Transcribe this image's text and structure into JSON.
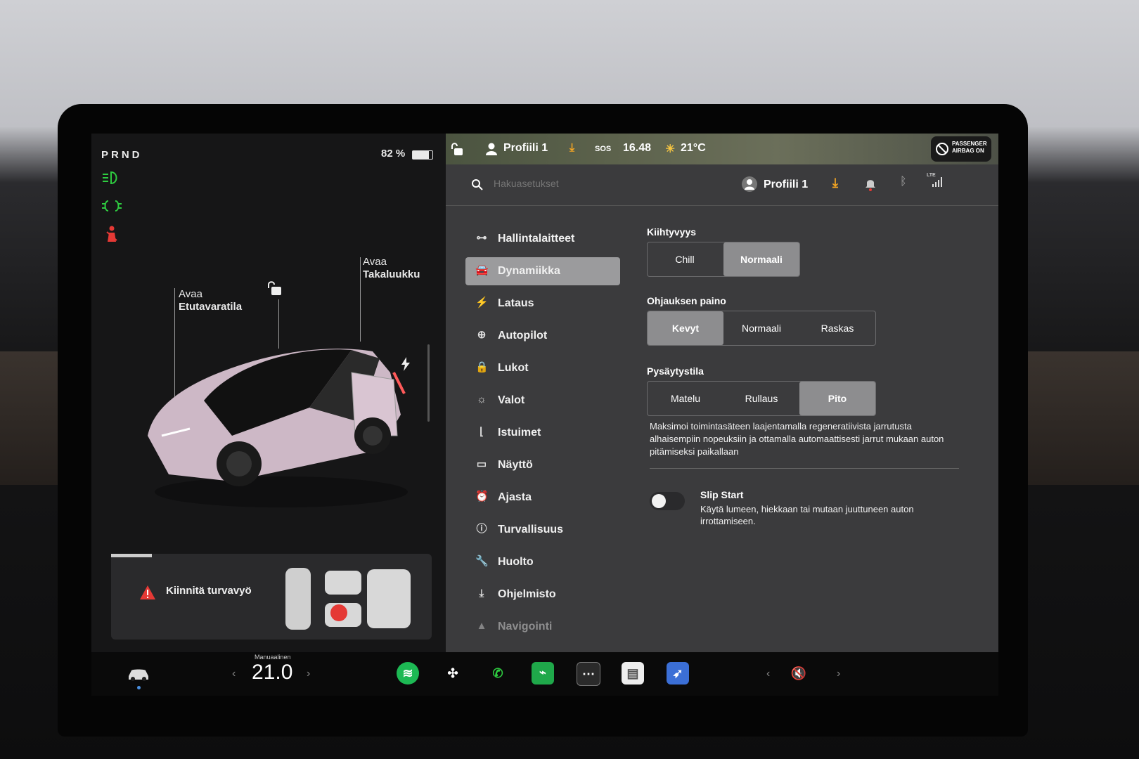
{
  "left_panel": {
    "gear": "PRND",
    "battery": "82 %",
    "battery_level": 0.82,
    "front_trunk": {
      "line1": "Avaa",
      "line2": "Etutavaratila"
    },
    "rear_trunk": {
      "line1": "Avaa",
      "line2": "Takaluukku"
    },
    "alert_text": "Kiinnitä turvavyö"
  },
  "topbar": {
    "profile": "Profiili 1",
    "sos": "SOS",
    "time": "16.48",
    "temperature": "21°C",
    "airbag_line1": "PASSENGER",
    "airbag_line2": "AIRBAG ON",
    "lte": "LTE"
  },
  "search": {
    "placeholder": "Hakuasetukset",
    "profile": "Profiili 1"
  },
  "nav": [
    {
      "label": "Hallintalaitteet",
      "icon": "toggle-icon"
    },
    {
      "label": "Dynamiikka",
      "icon": "car-icon"
    },
    {
      "label": "Lataus",
      "icon": "bolt-icon"
    },
    {
      "label": "Autopilot",
      "icon": "steering-wheel-icon"
    },
    {
      "label": "Lukot",
      "icon": "lock-icon"
    },
    {
      "label": "Valot",
      "icon": "sun-icon"
    },
    {
      "label": "Istuimet",
      "icon": "seat-icon"
    },
    {
      "label": "Näyttö",
      "icon": "display-icon"
    },
    {
      "label": "Ajasta",
      "icon": "alarm-clock-icon"
    },
    {
      "label": "Turvallisuus",
      "icon": "info-circle-icon"
    },
    {
      "label": "Huolto",
      "icon": "wrench-icon"
    },
    {
      "label": "Ohjelmisto",
      "icon": "download-icon"
    },
    {
      "label": "Navigointi",
      "icon": "navigation-icon"
    }
  ],
  "acceleration": {
    "title": "Kiihtyvyys",
    "options": [
      "Chill",
      "Normaali"
    ],
    "selected": "Normaali"
  },
  "steering": {
    "title": "Ohjauksen paino",
    "options": [
      "Kevyt",
      "Normaali",
      "Raskas"
    ],
    "selected": "Kevyt"
  },
  "stopping": {
    "title": "Pysäytystila",
    "options": [
      "Matelu",
      "Rullaus",
      "Pito"
    ],
    "selected": "Pito",
    "description": "Maksimoi toimintasäteen laajentamalla regeneratiivista jarrutusta alhaisempiin nopeuksiin ja ottamalla automaattisesti jarrut mukaan auton pitämiseksi paikallaan"
  },
  "slip_start": {
    "title": "Slip Start",
    "description": "Käytä lumeen, hiekkaan tai mutaan juuttuneen auton irrottamiseen.",
    "enabled": false
  },
  "dock": {
    "temp_label": "Manuaalinen",
    "temperature": "21.0"
  },
  "colors": {
    "accent_green": "#2ecc40",
    "warning_red": "#e53935",
    "download_orange": "#f5a623"
  }
}
